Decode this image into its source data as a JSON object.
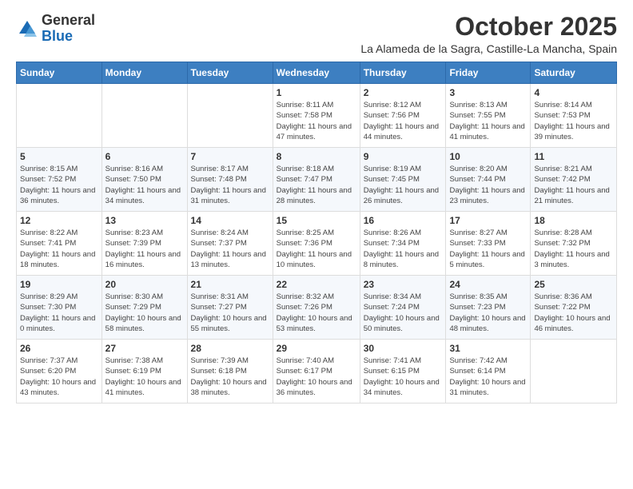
{
  "logo": {
    "general": "General",
    "blue": "Blue"
  },
  "title": "October 2025",
  "subtitle": "La Alameda de la Sagra, Castille-La Mancha, Spain",
  "days_of_week": [
    "Sunday",
    "Monday",
    "Tuesday",
    "Wednesday",
    "Thursday",
    "Friday",
    "Saturday"
  ],
  "weeks": [
    [
      {
        "day": "",
        "info": ""
      },
      {
        "day": "",
        "info": ""
      },
      {
        "day": "",
        "info": ""
      },
      {
        "day": "1",
        "info": "Sunrise: 8:11 AM\nSunset: 7:58 PM\nDaylight: 11 hours and 47 minutes."
      },
      {
        "day": "2",
        "info": "Sunrise: 8:12 AM\nSunset: 7:56 PM\nDaylight: 11 hours and 44 minutes."
      },
      {
        "day": "3",
        "info": "Sunrise: 8:13 AM\nSunset: 7:55 PM\nDaylight: 11 hours and 41 minutes."
      },
      {
        "day": "4",
        "info": "Sunrise: 8:14 AM\nSunset: 7:53 PM\nDaylight: 11 hours and 39 minutes."
      }
    ],
    [
      {
        "day": "5",
        "info": "Sunrise: 8:15 AM\nSunset: 7:52 PM\nDaylight: 11 hours and 36 minutes."
      },
      {
        "day": "6",
        "info": "Sunrise: 8:16 AM\nSunset: 7:50 PM\nDaylight: 11 hours and 34 minutes."
      },
      {
        "day": "7",
        "info": "Sunrise: 8:17 AM\nSunset: 7:48 PM\nDaylight: 11 hours and 31 minutes."
      },
      {
        "day": "8",
        "info": "Sunrise: 8:18 AM\nSunset: 7:47 PM\nDaylight: 11 hours and 28 minutes."
      },
      {
        "day": "9",
        "info": "Sunrise: 8:19 AM\nSunset: 7:45 PM\nDaylight: 11 hours and 26 minutes."
      },
      {
        "day": "10",
        "info": "Sunrise: 8:20 AM\nSunset: 7:44 PM\nDaylight: 11 hours and 23 minutes."
      },
      {
        "day": "11",
        "info": "Sunrise: 8:21 AM\nSunset: 7:42 PM\nDaylight: 11 hours and 21 minutes."
      }
    ],
    [
      {
        "day": "12",
        "info": "Sunrise: 8:22 AM\nSunset: 7:41 PM\nDaylight: 11 hours and 18 minutes."
      },
      {
        "day": "13",
        "info": "Sunrise: 8:23 AM\nSunset: 7:39 PM\nDaylight: 11 hours and 16 minutes."
      },
      {
        "day": "14",
        "info": "Sunrise: 8:24 AM\nSunset: 7:37 PM\nDaylight: 11 hours and 13 minutes."
      },
      {
        "day": "15",
        "info": "Sunrise: 8:25 AM\nSunset: 7:36 PM\nDaylight: 11 hours and 10 minutes."
      },
      {
        "day": "16",
        "info": "Sunrise: 8:26 AM\nSunset: 7:34 PM\nDaylight: 11 hours and 8 minutes."
      },
      {
        "day": "17",
        "info": "Sunrise: 8:27 AM\nSunset: 7:33 PM\nDaylight: 11 hours and 5 minutes."
      },
      {
        "day": "18",
        "info": "Sunrise: 8:28 AM\nSunset: 7:32 PM\nDaylight: 11 hours and 3 minutes."
      }
    ],
    [
      {
        "day": "19",
        "info": "Sunrise: 8:29 AM\nSunset: 7:30 PM\nDaylight: 11 hours and 0 minutes."
      },
      {
        "day": "20",
        "info": "Sunrise: 8:30 AM\nSunset: 7:29 PM\nDaylight: 10 hours and 58 minutes."
      },
      {
        "day": "21",
        "info": "Sunrise: 8:31 AM\nSunset: 7:27 PM\nDaylight: 10 hours and 55 minutes."
      },
      {
        "day": "22",
        "info": "Sunrise: 8:32 AM\nSunset: 7:26 PM\nDaylight: 10 hours and 53 minutes."
      },
      {
        "day": "23",
        "info": "Sunrise: 8:34 AM\nSunset: 7:24 PM\nDaylight: 10 hours and 50 minutes."
      },
      {
        "day": "24",
        "info": "Sunrise: 8:35 AM\nSunset: 7:23 PM\nDaylight: 10 hours and 48 minutes."
      },
      {
        "day": "25",
        "info": "Sunrise: 8:36 AM\nSunset: 7:22 PM\nDaylight: 10 hours and 46 minutes."
      }
    ],
    [
      {
        "day": "26",
        "info": "Sunrise: 7:37 AM\nSunset: 6:20 PM\nDaylight: 10 hours and 43 minutes."
      },
      {
        "day": "27",
        "info": "Sunrise: 7:38 AM\nSunset: 6:19 PM\nDaylight: 10 hours and 41 minutes."
      },
      {
        "day": "28",
        "info": "Sunrise: 7:39 AM\nSunset: 6:18 PM\nDaylight: 10 hours and 38 minutes."
      },
      {
        "day": "29",
        "info": "Sunrise: 7:40 AM\nSunset: 6:17 PM\nDaylight: 10 hours and 36 minutes."
      },
      {
        "day": "30",
        "info": "Sunrise: 7:41 AM\nSunset: 6:15 PM\nDaylight: 10 hours and 34 minutes."
      },
      {
        "day": "31",
        "info": "Sunrise: 7:42 AM\nSunset: 6:14 PM\nDaylight: 10 hours and 31 minutes."
      },
      {
        "day": "",
        "info": ""
      }
    ]
  ]
}
